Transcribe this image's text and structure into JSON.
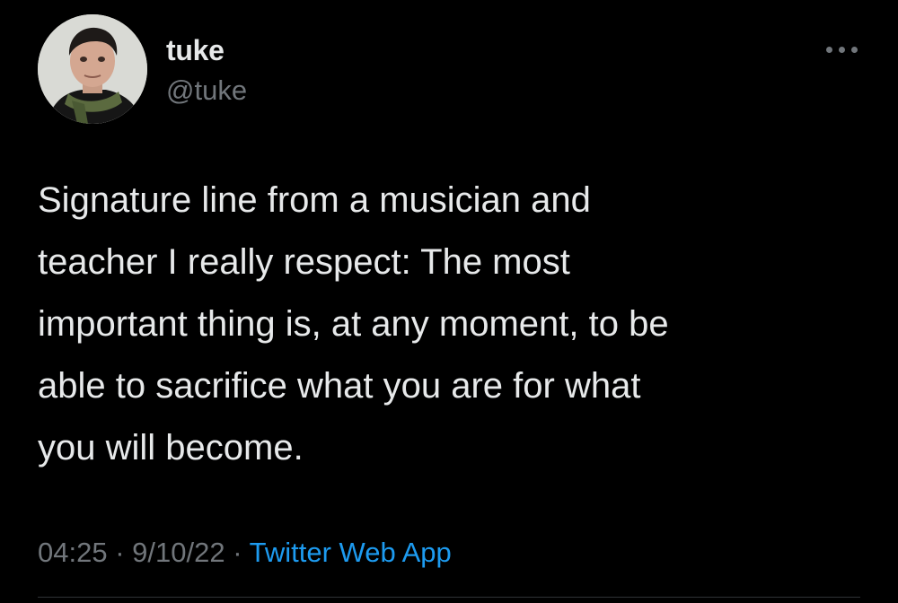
{
  "author": {
    "name": "tuke",
    "handle": "@tuke",
    "avatar_icon": "profile-photo"
  },
  "more_icon": "more-options-icon",
  "tweet": {
    "text": "Signature line from a musician and\nteacher I really respect: The most\nimportant thing is, at any moment, to be\nable to sacrifice what you are for what\nyou will become."
  },
  "meta": {
    "time": "04:25",
    "separator": "·",
    "date": "9/10/22",
    "source": "Twitter Web App"
  },
  "colors": {
    "background": "#000000",
    "text": "#e7e9ea",
    "secondary": "#71767b",
    "link": "#1d9bf0"
  }
}
